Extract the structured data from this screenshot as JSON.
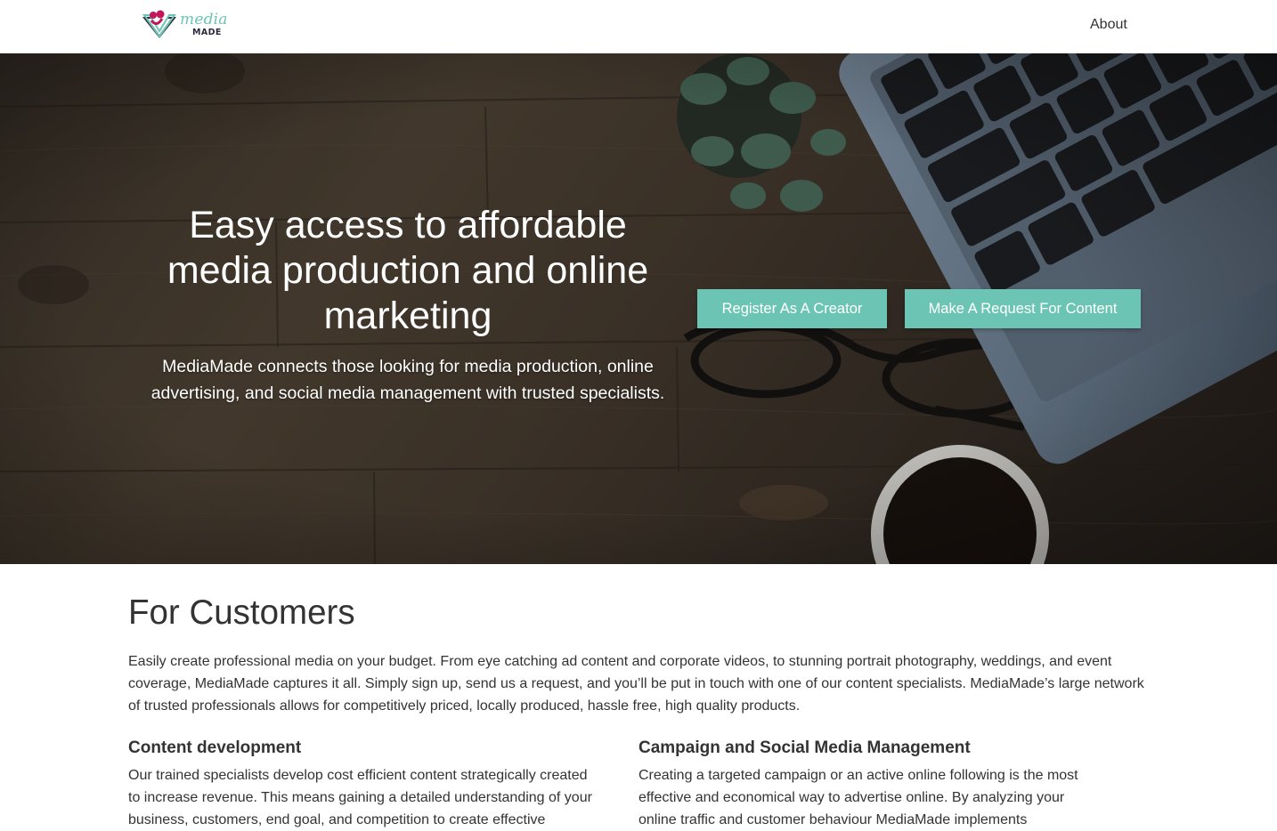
{
  "navbar": {
    "logo": {
      "word1": "media",
      "word2": "MADE"
    },
    "links": [
      {
        "label": "About"
      }
    ]
  },
  "hero": {
    "title": "Easy access to affordable media production and online marketing",
    "subtitle": "MediaMade connects those looking for media production, online advertising, and social media management with trusted specialists.",
    "buttons": {
      "creator": "Register As A Creator",
      "request": "Make A Request For Content"
    }
  },
  "customers": {
    "title": "For Customers",
    "intro": "Easily create professional media on your budget. From eye catching ad content and corporate videos, to stunning portrait photography, weddings, and event coverage, MediaMade captures it all. Simply sign up, send us a request, and you’ll be put in touch with one of our content specialists. MediaMade’s large network of trusted professionals allows for competitively priced, locally produced, hassle free, high quality products.",
    "columns": [
      {
        "heading": "Content development",
        "text": "Our trained specialists develop cost efficient content strategically created to increase revenue. This means gaining a detailed understanding of your business, customers, end goal, and competition to create effective"
      },
      {
        "heading": "Campaign and Social Media Management",
        "text": "Creating a targeted campaign or an active online following is the most effective and economical way to advertise online. By analyzing your online traffic and customer behaviour MediaMade implements"
      }
    ]
  },
  "colors": {
    "accent": "#6cc5b4",
    "logo_pink": "#c2185b",
    "logo_navy": "#2b2b3d",
    "text": "#333333"
  }
}
